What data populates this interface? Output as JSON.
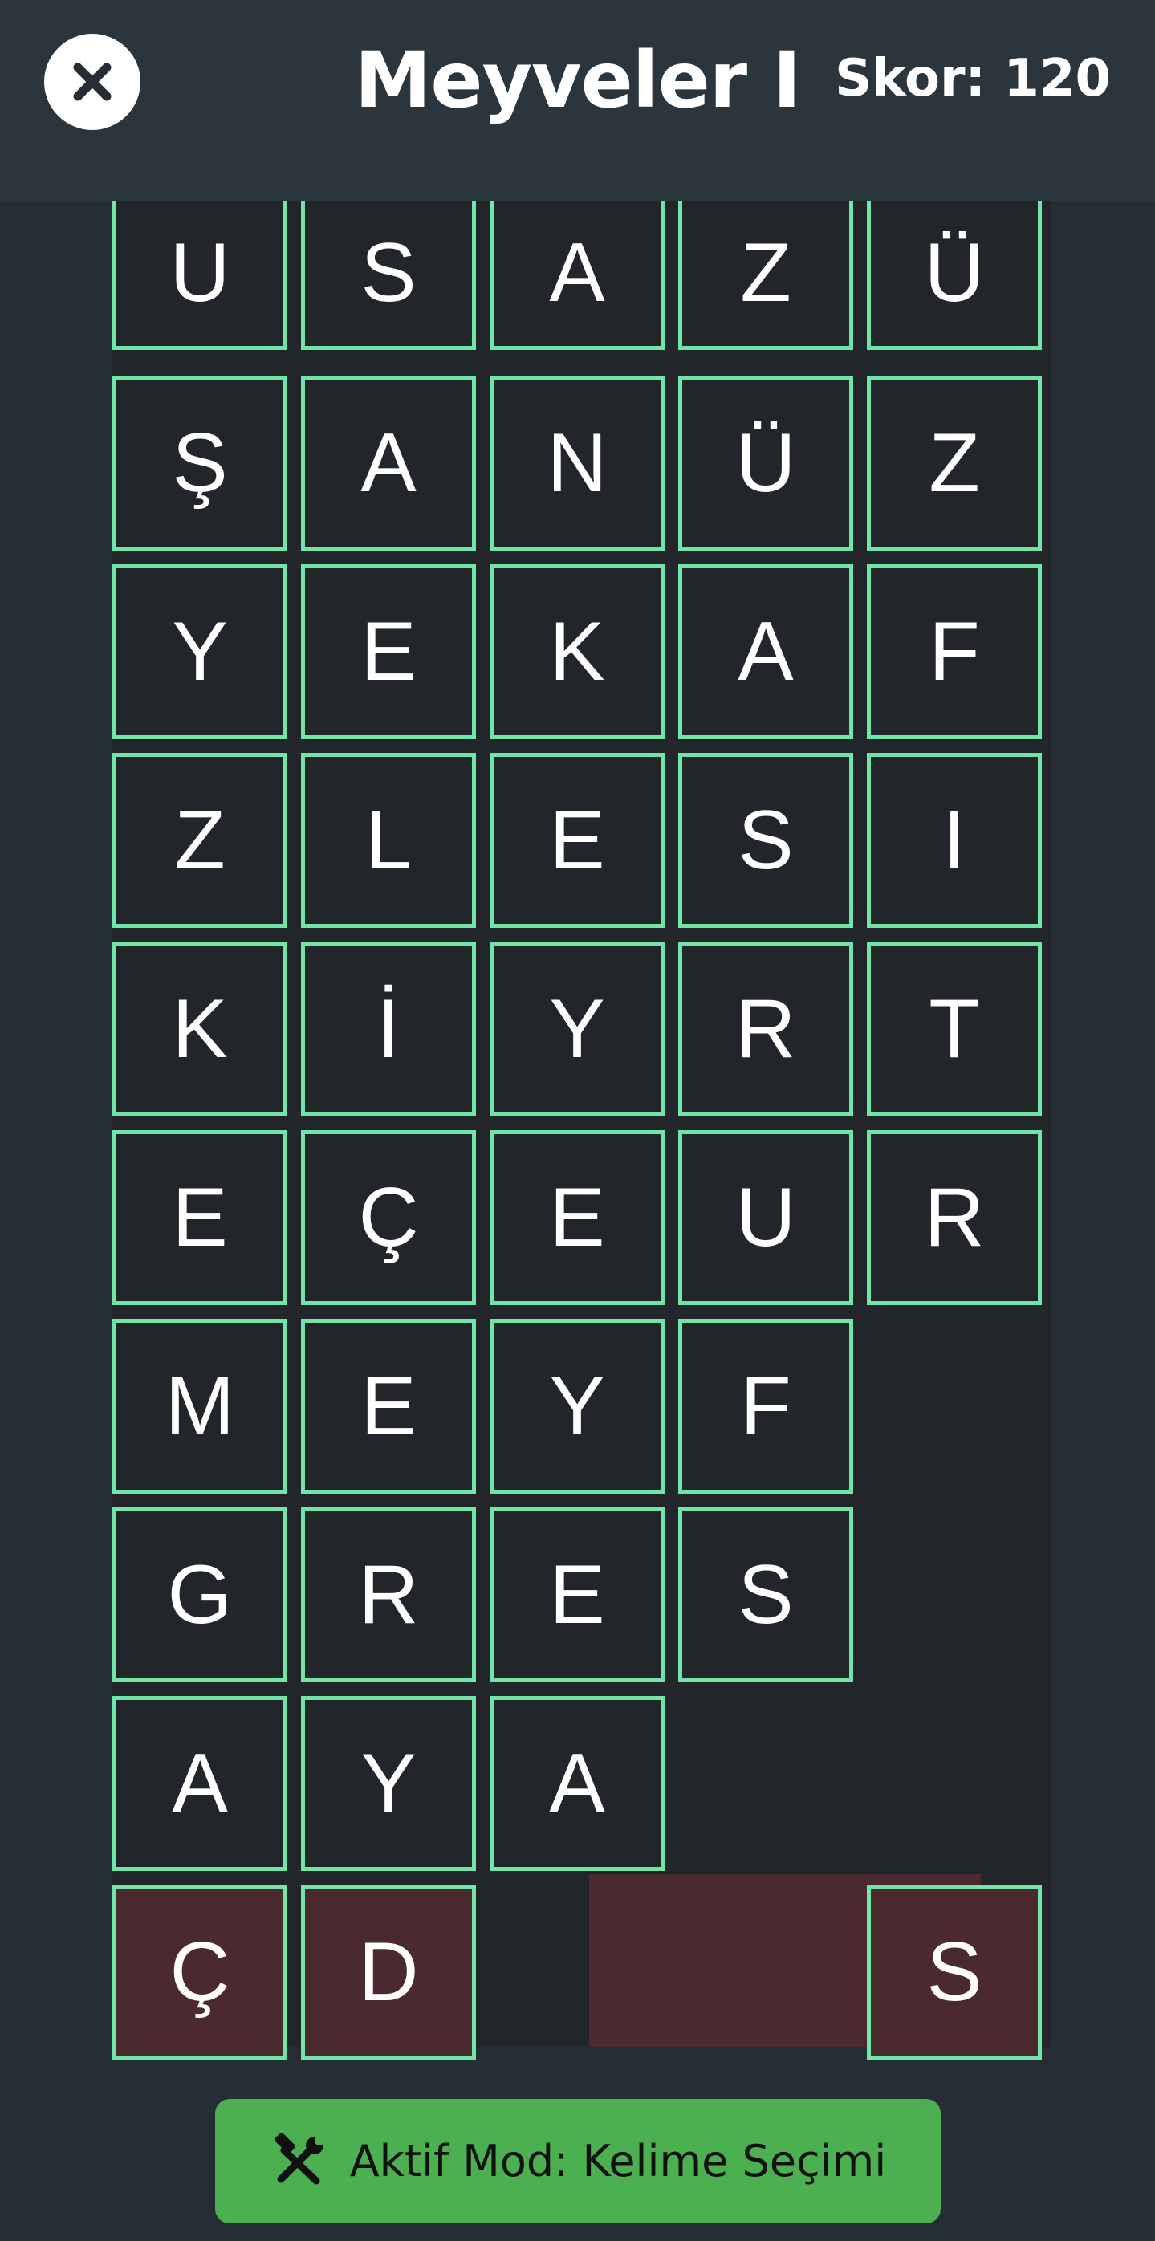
{
  "header": {
    "title": "Meyveler I",
    "score": "Skor: 120",
    "close_icon": "close-icon"
  },
  "grid": {
    "rows": [
      [
        "U",
        "S",
        "A",
        "Z",
        "Ü"
      ],
      [
        "Ş",
        "A",
        "N",
        "Ü",
        "Z"
      ],
      [
        "Y",
        "E",
        "K",
        "A",
        "F"
      ],
      [
        "Z",
        "L",
        "E",
        "S",
        "I"
      ],
      [
        "K",
        "İ",
        "Y",
        "R",
        "T"
      ],
      [
        "E",
        "Ç",
        "E",
        "U",
        "R"
      ],
      [
        "M",
        "E",
        "Y",
        "F",
        ""
      ],
      [
        "G",
        "R",
        "E",
        "S",
        ""
      ],
      [
        "A",
        "Y",
        "A",
        "",
        ""
      ],
      [
        "Ç",
        "D",
        "",
        "",
        "S"
      ]
    ],
    "highlighted_row_color": "#4a2a2f",
    "tile_border_color": "#6ee7a8"
  },
  "mode_button": {
    "label": "Aktif Mod: Kelime Seçimi",
    "icon": "tools-icon",
    "color": "#4caf50"
  }
}
